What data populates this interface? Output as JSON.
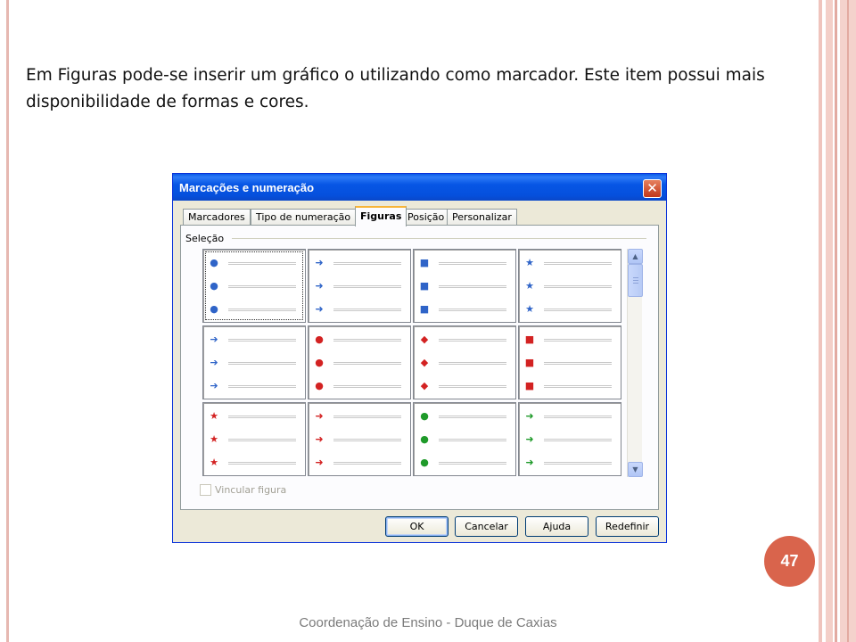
{
  "slide": {
    "body_text": "Em Figuras pode-se inserir um gráfico o utilizando como marcador. Este item possui mais disponibilidade de formas e cores.",
    "page_number": "47",
    "footer": "Coordenação de Ensino - Duque de Caxias"
  },
  "dialog": {
    "title": "Marcações e numeração",
    "close_glyph": "✕",
    "tabs": [
      "Marcadores",
      "Tipo de numeração",
      "Figuras",
      "Posição",
      "Personalizar"
    ],
    "active_tab": "Figuras",
    "group_label": "Seleção",
    "gallery": [
      {
        "shape": "ball",
        "color": "#2f64c8",
        "glyph": "●"
      },
      {
        "shape": "arrow",
        "color": "#2f64c8",
        "glyph": "➜"
      },
      {
        "shape": "square",
        "color": "#2f64c8",
        "glyph": "■"
      },
      {
        "shape": "star",
        "color": "#2f64c8",
        "glyph": "★"
      },
      {
        "shape": "arrow-right",
        "color": "#2f64c8",
        "glyph": "➔"
      },
      {
        "shape": "ball",
        "color": "#d32222",
        "glyph": "●"
      },
      {
        "shape": "diamond-arrow",
        "color": "#d32222",
        "glyph": "◆"
      },
      {
        "shape": "square",
        "color": "#d32222",
        "glyph": "■"
      },
      {
        "shape": "star",
        "color": "#d32222",
        "glyph": "★"
      },
      {
        "shape": "arrow",
        "color": "#d32222",
        "glyph": "➜"
      },
      {
        "shape": "ball",
        "color": "#1f9a2a",
        "glyph": "●"
      },
      {
        "shape": "arrow-down",
        "color": "#1f9a2a",
        "glyph": "➜"
      }
    ],
    "selected_index": 0,
    "scroll_up_glyph": "▲",
    "scroll_down_glyph": "▼",
    "link_checkbox_label": "Vincular figura",
    "link_checked": false,
    "buttons": {
      "ok": "OK",
      "cancel": "Cancelar",
      "help": "Ajuda",
      "reset": "Redefinir"
    }
  }
}
